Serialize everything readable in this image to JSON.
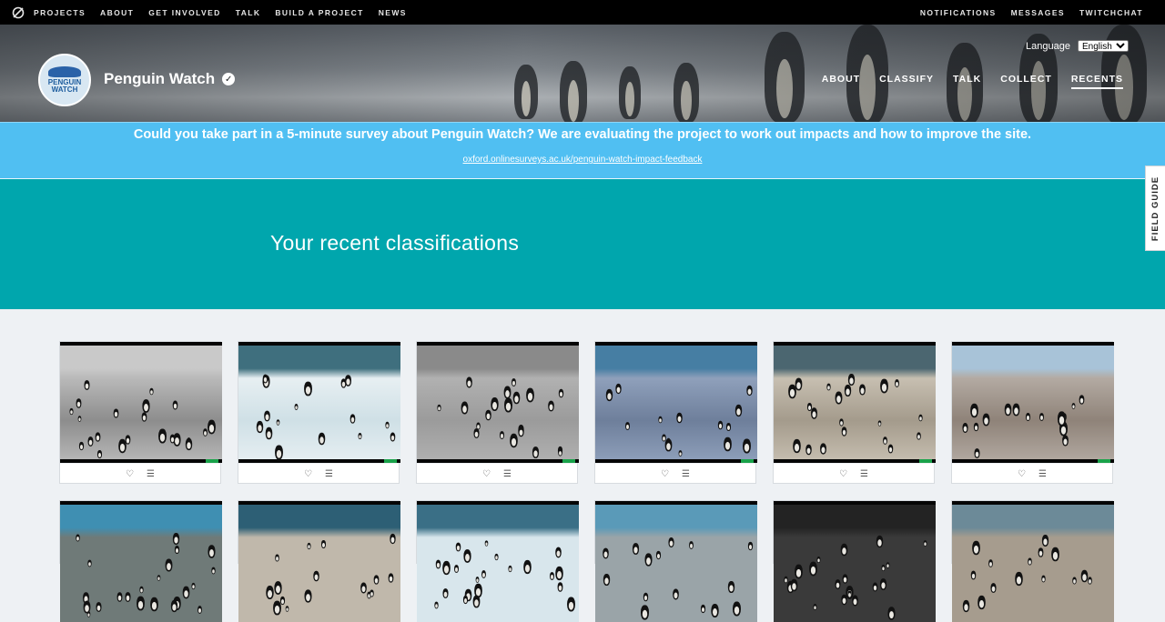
{
  "topnav": {
    "links": [
      "PROJECTS",
      "ABOUT",
      "GET INVOLVED",
      "TALK",
      "BUILD A PROJECT",
      "NEWS"
    ],
    "right": [
      "NOTIFICATIONS",
      "MESSAGES",
      "TWITCHCHAT"
    ]
  },
  "header": {
    "language_label": "Language",
    "language_value": "English",
    "project_title": "Penguin Watch",
    "logo_text_1": "PENGUIN",
    "logo_text_2": "WATCH",
    "nav": [
      "ABOUT",
      "CLASSIFY",
      "TALK",
      "COLLECT",
      "RECENTS"
    ],
    "active_nav": "RECENTS"
  },
  "survey": {
    "message": "Could you take part in a 5-minute survey about Penguin Watch? We are evaluating the project to work out impacts and how to improve the site.",
    "link": "oxford.onlinesurveys.ac.uk/penguin-watch-impact-feedback"
  },
  "recents": {
    "heading": "Your recent classifications"
  },
  "field_guide": "FIELD GUIDE",
  "icons": {
    "favorite": "♡",
    "collect": "☰"
  },
  "thumbs_row1": [
    {
      "sky": "#c9c9c9",
      "ground": "#8d8d8d",
      "snow": "#b9b9b9"
    },
    {
      "sky": "#3f6f7e",
      "ground": "#cfe0e6",
      "snow": "#e7eff2"
    },
    {
      "sky": "#8a8a8a",
      "ground": "#9b9b9b",
      "snow": "#b1b1b1"
    },
    {
      "sky": "#467ea3",
      "ground": "#6e7f9b",
      "snow": "#8fa0bb"
    },
    {
      "sky": "#4b6670",
      "ground": "#a49b8c",
      "snow": "#c7bfb1"
    },
    {
      "sky": "#a8c3d8",
      "ground": "#8f8379",
      "snow": "#b3aaa2"
    }
  ],
  "thumbs_row2": [
    {
      "sky": "#3f8fb2",
      "ground": "#6f7a78"
    },
    {
      "sky": "#2d5f75",
      "ground": "#c0b8ab"
    },
    {
      "sky": "#3a6f86",
      "ground": "#d8e6ec"
    },
    {
      "sky": "#5a9ab8",
      "ground": "#9aa4a8"
    },
    {
      "sky": "#232323",
      "ground": "#3a3a3a"
    },
    {
      "sky": "#6c8a98",
      "ground": "#a69c8e"
    }
  ]
}
